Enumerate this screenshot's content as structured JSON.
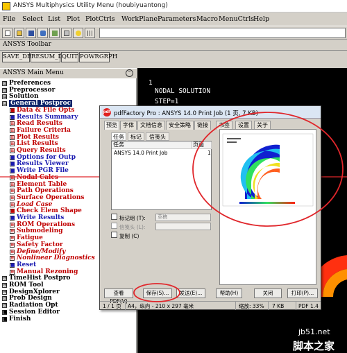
{
  "window": {
    "title": "ANSYS Multiphysics Utility Menu (houbiyuantong)"
  },
  "menu": [
    "File",
    "Select",
    "List",
    "Plot",
    "PlotCtrls",
    "WorkPlane",
    "Parameters",
    "Macro",
    "MenuCtrls",
    "Help"
  ],
  "toolbar": {
    "title": "ANSYS Toolbar",
    "buttons": [
      "SAVE_DB",
      "RESUM_DB",
      "QUIT",
      "POWRGRPH"
    ]
  },
  "main_menu": {
    "title": "ANSYS Main Menu",
    "collapse_icon": "double-chevron-up-icon",
    "items": [
      {
        "label": "Preferences",
        "box": "⊞"
      },
      {
        "label": "Preprocessor",
        "box": "⊞"
      },
      {
        "label": "Solution",
        "box": "⊞"
      },
      {
        "label": "General Postproc",
        "box": "⊟"
      },
      {
        "label": "Data & File Opts",
        "box": "■"
      },
      {
        "label": "Results Summary",
        "box": "■"
      },
      {
        "label": "Read Results",
        "box": "⊞"
      },
      {
        "label": "Failure Criteria",
        "box": "⊞"
      },
      {
        "label": "Plot Results",
        "box": "⊞"
      },
      {
        "label": "List Results",
        "box": "⊞"
      },
      {
        "label": "Query Results",
        "box": "⊞"
      },
      {
        "label": "Options for Outp",
        "box": "■"
      },
      {
        "label": "Results Viewer",
        "box": "■"
      },
      {
        "label": "Write PGR File",
        "box": "■"
      },
      {
        "label": "Nodal Calcs",
        "box": "⊞"
      },
      {
        "label": "Element Table",
        "box": "⊞"
      },
      {
        "label": "Path Operations",
        "box": "⊞"
      },
      {
        "label": "Surface Operations",
        "box": "⊞"
      },
      {
        "label": "Load Case",
        "box": "⊞"
      },
      {
        "label": "Check Elem Shape",
        "box": "■"
      },
      {
        "label": "Write Results",
        "box": "■"
      },
      {
        "label": "ROM Operations",
        "box": "⊞"
      },
      {
        "label": "Submodeling",
        "box": "⊞"
      },
      {
        "label": "Fatigue",
        "box": "⊞"
      },
      {
        "label": "Safety Factor",
        "box": "⊞"
      },
      {
        "label": "Define/Modify",
        "box": "⊞"
      },
      {
        "label": "Nonlinear Diagnostics",
        "box": "⊞"
      },
      {
        "label": "Reset",
        "box": "■"
      },
      {
        "label": "Manual Rezoning",
        "box": "⊞"
      },
      {
        "label": "TimeHist Postpro",
        "box": "⊞"
      },
      {
        "label": "ROM Tool",
        "box": "⊞"
      },
      {
        "label": "DesignXplorer",
        "box": "⊞"
      },
      {
        "label": "Prob Design",
        "box": "⊞"
      },
      {
        "label": "Radiation Opt",
        "box": "⊞"
      },
      {
        "label": "Session Editor",
        "box": "■"
      },
      {
        "label": "Finish",
        "box": "■"
      }
    ]
  },
  "graphics": {
    "window_number": "1",
    "line1": "NODAL SOLUTION",
    "line2": "STEP=1"
  },
  "dialog": {
    "title": "pdfFactory Pro : ANSYS 14.0 Print Job (1 页, 7 KB)",
    "logo_text": "pdf",
    "tabs": [
      "预览",
      "字体",
      "文档信息",
      "安全策略",
      "链接",
      "书签",
      "设置",
      "关于"
    ],
    "subtabs": [
      "任务",
      "标记",
      "信笺头"
    ],
    "job_headers": [
      "任务",
      "页面"
    ],
    "job_name": "ANSYS 14.0 Print Job",
    "job_pages": "1",
    "options": [
      {
        "label": "标记组 (T):",
        "value": "草稿"
      },
      {
        "label": "信笺头 (L):",
        "value": ""
      },
      {
        "label": "复制 (C)",
        "value": ""
      }
    ],
    "buttons": [
      "查看 PDF(V)",
      "保存(S)...",
      "发送(E)...",
      "帮助(H)",
      "关闭",
      "打印(P)..."
    ],
    "status": {
      "page": "1 / 1 页",
      "paper": "A4，纵向 - 210 x 297 毫米",
      "zoom": "缩放: 33%",
      "size": "7 KB",
      "pdf_version": "PDF 1.4"
    }
  },
  "watermark": {
    "site": "jb51.net",
    "brand": "脚本之家"
  },
  "colors": {
    "annotation_red": "#e0262b",
    "tree_red": "#d00000",
    "selected_bg": "#0a246a"
  }
}
